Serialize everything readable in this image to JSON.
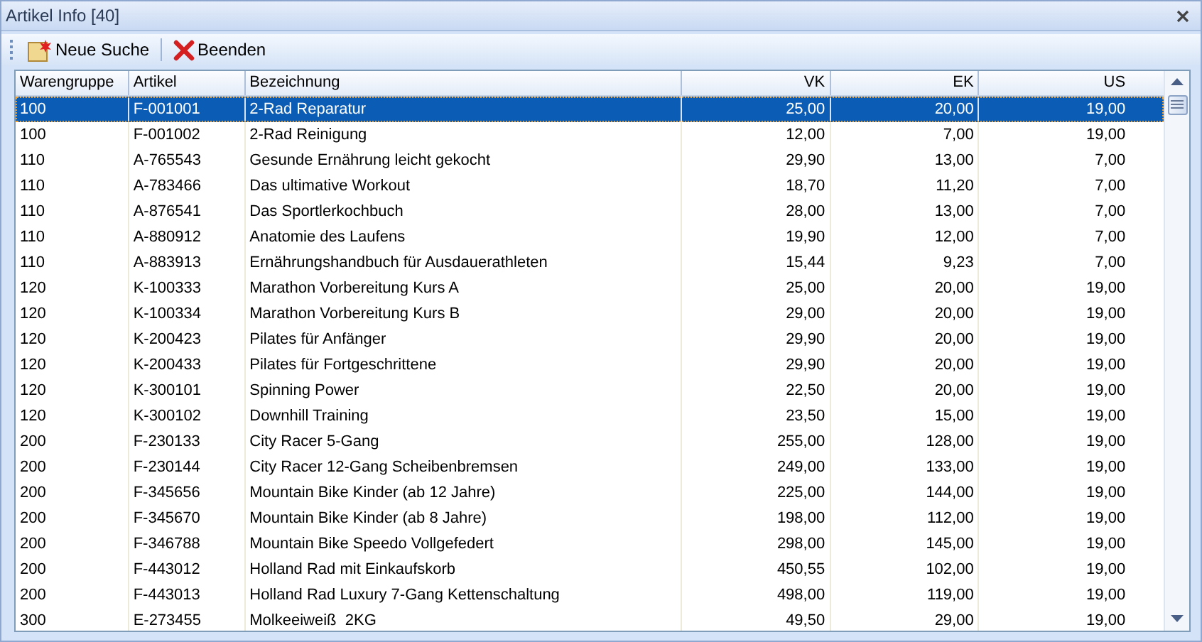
{
  "window": {
    "title": "Artikel Info [40]"
  },
  "toolbar": {
    "buttons": [
      {
        "kind": "new",
        "label": "Neue Suche"
      },
      {
        "kind": "exit",
        "label": "Beenden"
      }
    ]
  },
  "table": {
    "columns": [
      "Warengruppe",
      "Artikel",
      "Bezeichnung",
      "VK",
      "EK",
      "US"
    ],
    "rows": [
      {
        "selected": true,
        "cells": [
          "100",
          "F-001001",
          "2-Rad Reparatur",
          "25,00",
          "20,00",
          "19,00"
        ]
      },
      {
        "selected": false,
        "cells": [
          "100",
          "F-001002",
          "2-Rad Reinigung",
          "12,00",
          "7,00",
          "19,00"
        ]
      },
      {
        "selected": false,
        "cells": [
          "110",
          "A-765543",
          "Gesunde Ernährung leicht gekocht",
          "29,90",
          "13,00",
          "7,00"
        ]
      },
      {
        "selected": false,
        "cells": [
          "110",
          "A-783466",
          "Das ultimative Workout",
          "18,70",
          "11,20",
          "7,00"
        ]
      },
      {
        "selected": false,
        "cells": [
          "110",
          "A-876541",
          "Das Sportlerkochbuch",
          "28,00",
          "13,00",
          "7,00"
        ]
      },
      {
        "selected": false,
        "cells": [
          "110",
          "A-880912",
          "Anatomie des Laufens",
          "19,90",
          "12,00",
          "7,00"
        ]
      },
      {
        "selected": false,
        "cells": [
          "110",
          "A-883913",
          "Ernährungshandbuch für Ausdauerathleten",
          "15,44",
          "9,23",
          "7,00"
        ]
      },
      {
        "selected": false,
        "cells": [
          "120",
          "K-100333",
          "Marathon Vorbereitung Kurs A",
          "25,00",
          "20,00",
          "19,00"
        ]
      },
      {
        "selected": false,
        "cells": [
          "120",
          "K-100334",
          "Marathon Vorbereitung Kurs B",
          "29,00",
          "20,00",
          "19,00"
        ]
      },
      {
        "selected": false,
        "cells": [
          "120",
          "K-200423",
          "Pilates für Anfänger",
          "29,90",
          "20,00",
          "19,00"
        ]
      },
      {
        "selected": false,
        "cells": [
          "120",
          "K-200433",
          "Pilates für Fortgeschrittene",
          "29,90",
          "20,00",
          "19,00"
        ]
      },
      {
        "selected": false,
        "cells": [
          "120",
          "K-300101",
          "Spinning Power",
          "22,50",
          "20,00",
          "19,00"
        ]
      },
      {
        "selected": false,
        "cells": [
          "120",
          "K-300102",
          "Downhill Training",
          "23,50",
          "15,00",
          "19,00"
        ]
      },
      {
        "selected": false,
        "cells": [
          "200",
          "F-230133",
          "City Racer 5-Gang",
          "255,00",
          "128,00",
          "19,00"
        ]
      },
      {
        "selected": false,
        "cells": [
          "200",
          "F-230144",
          "City Racer 12-Gang Scheibenbremsen",
          "249,00",
          "133,00",
          "19,00"
        ]
      },
      {
        "selected": false,
        "cells": [
          "200",
          "F-345656",
          "Mountain Bike Kinder (ab 12 Jahre)",
          "225,00",
          "144,00",
          "19,00"
        ]
      },
      {
        "selected": false,
        "cells": [
          "200",
          "F-345670",
          "Mountain Bike Kinder (ab 8 Jahre)",
          "198,00",
          "112,00",
          "19,00"
        ]
      },
      {
        "selected": false,
        "cells": [
          "200",
          "F-346788",
          "Mountain Bike Speedo Vollgefedert",
          "298,00",
          "145,00",
          "19,00"
        ]
      },
      {
        "selected": false,
        "cells": [
          "200",
          "F-443012",
          "Holland Rad mit Einkaufskorb",
          "450,55",
          "102,00",
          "19,00"
        ]
      },
      {
        "selected": false,
        "cells": [
          "200",
          "F-443013",
          "Holland Rad Luxury 7-Gang Kettenschaltung",
          "498,00",
          "119,00",
          "19,00"
        ]
      },
      {
        "selected": false,
        "cells": [
          "300",
          "E-273455",
          "Molkeeiweiß  2KG",
          "49,50",
          "29,00",
          "19,00"
        ]
      }
    ]
  }
}
